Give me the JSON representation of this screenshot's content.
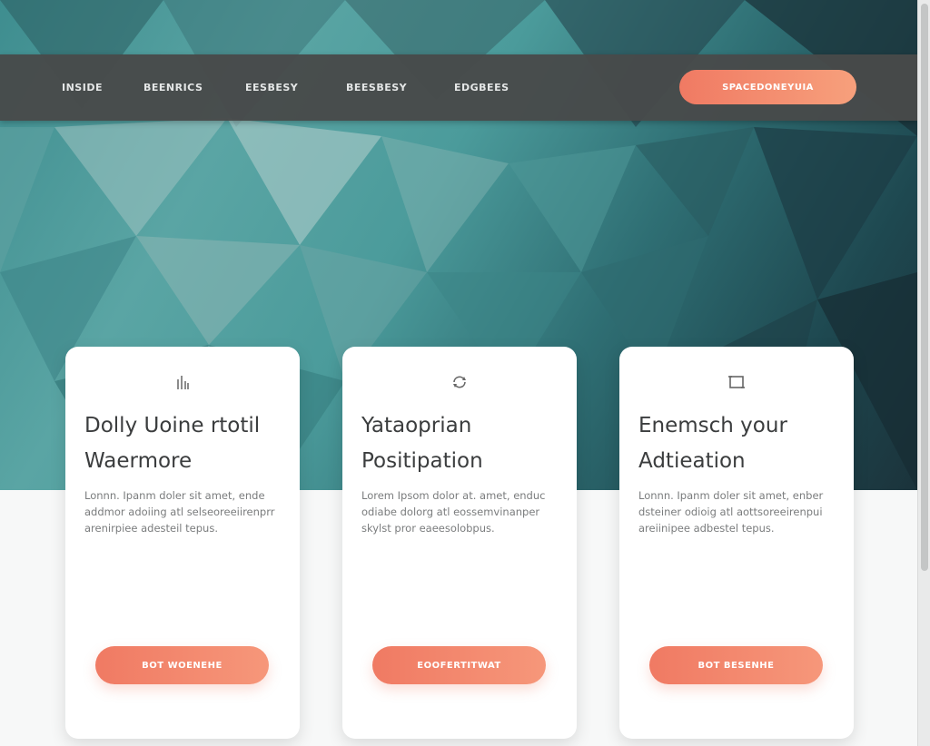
{
  "nav": {
    "links": [
      {
        "label": "INSIDE"
      },
      {
        "label": "BEENRICS"
      },
      {
        "label": "EESBESY"
      },
      {
        "label": "BEESBESY"
      },
      {
        "label": "EDGBEES"
      }
    ],
    "cta_label": "SPACEDONEYUIA"
  },
  "cards": [
    {
      "icon": "bar-chart-icon",
      "title_line1": "Dolly Uoine rtotil",
      "title_line2": "Waermore",
      "body": "Lonnn. Ipanm doler sit amet, ende addmor adoiing atl selseoreeiirenprr arenirpiee adesteil tepus.",
      "button_label": "BOT WOENEHE"
    },
    {
      "icon": "refresh-icon",
      "title_line1": "Yataoprian",
      "title_line2": "Positipation",
      "body": "Lorem Ipsom dolor at. amet, enduc odiabe dolorg atl eossemvinanper skylst pror eaeesolobpus.",
      "button_label": "EOOFERTITWAT"
    },
    {
      "icon": "frame-icon",
      "title_line1": "Enemsch your",
      "title_line2": "Adtieation",
      "body": "Lonnn. Ipanm doler sit amet, enber dsteiner odioig atl aottsoreeirenpui areiinipee adbestel tepus.",
      "button_label": "BOT BESENHE"
    }
  ],
  "colors": {
    "accent_start": "#f07a63",
    "accent_end": "#f7a07c",
    "nav_bg": "#484a4a",
    "hero_teal": "#4b9b9b",
    "hero_dark": "#1b333b"
  }
}
